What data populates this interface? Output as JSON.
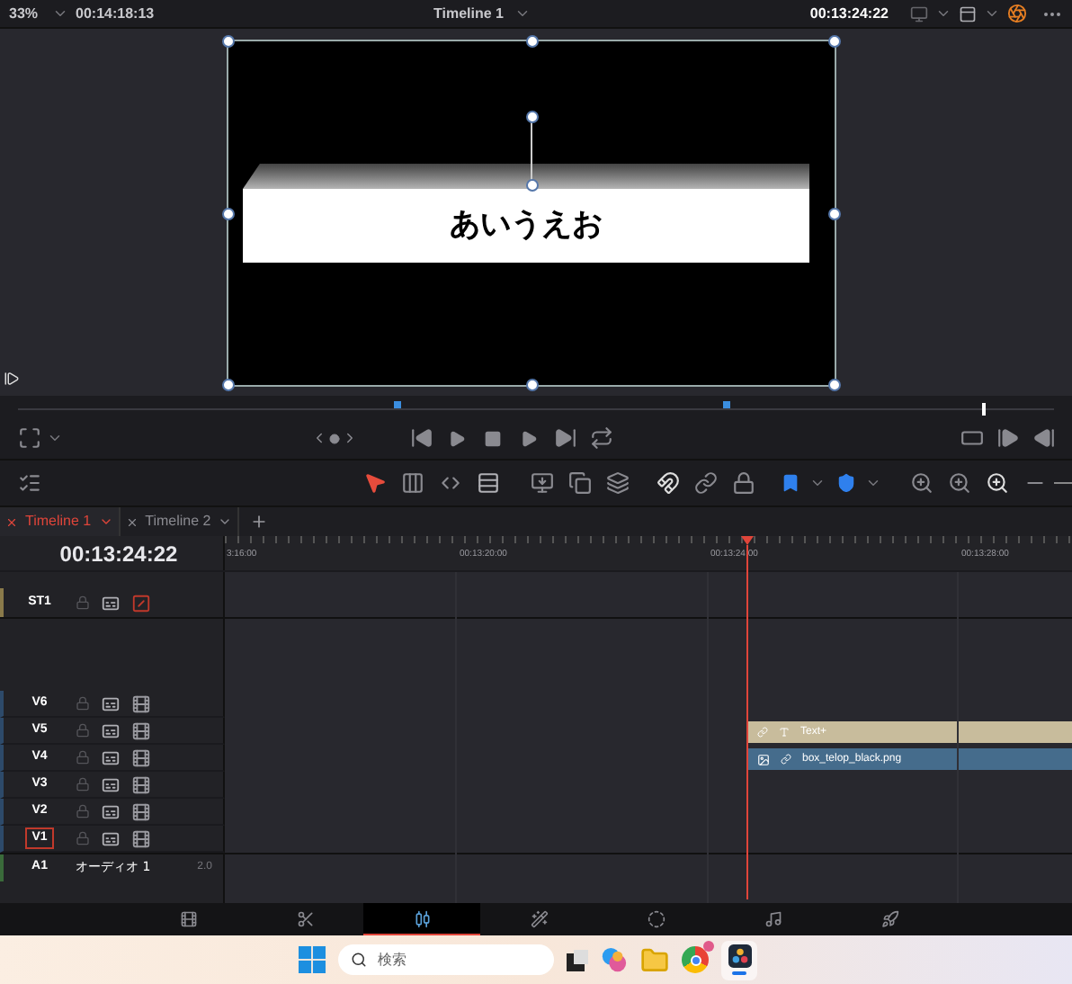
{
  "top_bar": {
    "zoom": "33%",
    "source_timecode": "00:14:18:13",
    "timeline_name": "Timeline 1",
    "record_timecode": "00:13:24:22"
  },
  "viewer": {
    "title_text": "あいうえお"
  },
  "scrubber": {
    "level": 0.93
  },
  "zoom_slider": {
    "level": 1
  },
  "timeline_tabs": [
    {
      "label": "Timeline 1",
      "selected": true
    },
    {
      "label": "Timeline 2",
      "selected": false
    }
  ],
  "timecode": "00:13:24:22",
  "ruler": [
    "3:16:00",
    "00:13:20:00",
    "00:13:24:00",
    "00:13:28:00"
  ],
  "subtitle_tracks": [
    {
      "name": "ST1"
    }
  ],
  "video_tracks": [
    {
      "name": "V6",
      "selected": false
    },
    {
      "name": "V5",
      "selected": false,
      "clip": {
        "kind": "text",
        "label": "Text+"
      }
    },
    {
      "name": "V4",
      "selected": false,
      "clip": {
        "kind": "image",
        "label": "box_telop_black.png"
      }
    },
    {
      "name": "V3",
      "selected": false
    },
    {
      "name": "V2",
      "selected": false
    },
    {
      "name": "V1",
      "selected": true
    }
  ],
  "audio_tracks": [
    {
      "name": "A1",
      "title": "オーディオ 1",
      "channels": "2.0"
    }
  ],
  "page_tabs": [
    {
      "kind": "media",
      "selected": false
    },
    {
      "kind": "cut",
      "selected": false
    },
    {
      "kind": "edit",
      "selected": true
    },
    {
      "kind": "fusion",
      "selected": false
    },
    {
      "kind": "color",
      "selected": false
    },
    {
      "kind": "fairlight",
      "selected": false
    },
    {
      "kind": "deliver",
      "selected": false
    }
  ],
  "taskbar": {
    "search_placeholder": "検索"
  }
}
